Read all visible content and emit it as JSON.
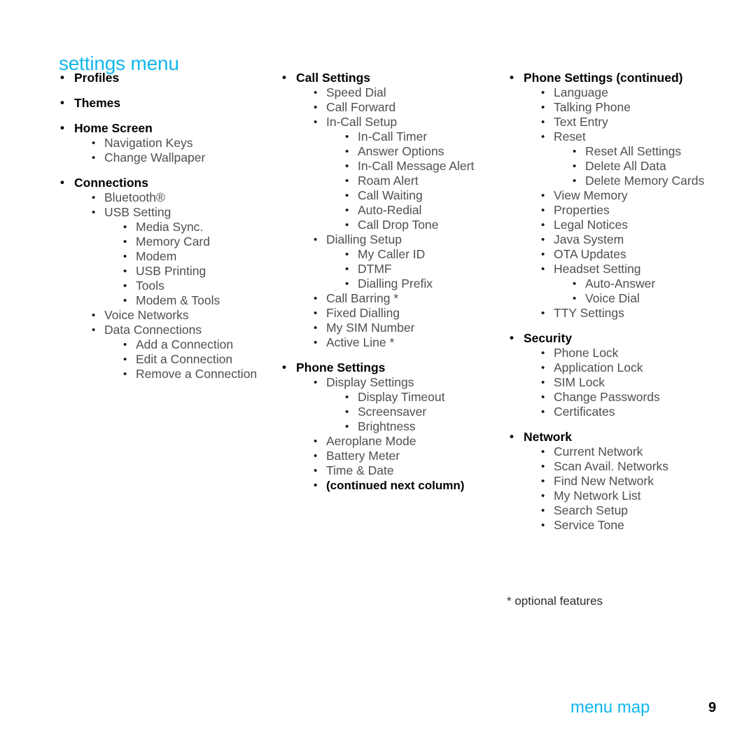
{
  "title": "settings menu",
  "bullet_glyph": "•",
  "colors": {
    "accent": "#11b7ec",
    "heading_text": "#000000",
    "sub_text": "#4f4f4f",
    "background": "#ffffff"
  },
  "footnote": "* optional features",
  "footer": {
    "label": "menu map",
    "page_number": "9"
  },
  "columns": [
    {
      "id": "column-1",
      "items": [
        {
          "level": 1,
          "label": "Profiles"
        },
        {
          "level": 1,
          "label": "Themes"
        },
        {
          "level": 1,
          "label": "Home Screen"
        },
        {
          "level": 2,
          "label": "Navigation Keys"
        },
        {
          "level": 2,
          "label": "Change Wallpaper"
        },
        {
          "level": 1,
          "label": "Connections"
        },
        {
          "level": 2,
          "label": "Bluetooth®"
        },
        {
          "level": 2,
          "label": "USB Setting"
        },
        {
          "level": 3,
          "label": "Media Sync."
        },
        {
          "level": 3,
          "label": "Memory Card"
        },
        {
          "level": 3,
          "label": "Modem"
        },
        {
          "level": 3,
          "label": "USB Printing"
        },
        {
          "level": 3,
          "label": "Tools"
        },
        {
          "level": 3,
          "label": "Modem & Tools"
        },
        {
          "level": 2,
          "label": "Voice Networks"
        },
        {
          "level": 2,
          "label": "Data Connections"
        },
        {
          "level": 3,
          "label": "Add a Connection"
        },
        {
          "level": 3,
          "label": "Edit a Connection"
        },
        {
          "level": 3,
          "label": "Remove a Connection"
        }
      ]
    },
    {
      "id": "column-2",
      "items": [
        {
          "level": 1,
          "label": "Call Settings"
        },
        {
          "level": 2,
          "label": "Speed Dial"
        },
        {
          "level": 2,
          "label": "Call Forward"
        },
        {
          "level": 2,
          "label": "In-Call Setup"
        },
        {
          "level": 3,
          "label": "In-Call Timer"
        },
        {
          "level": 3,
          "label": "Answer Options"
        },
        {
          "level": 3,
          "label": "In-Call Message Alert"
        },
        {
          "level": 3,
          "label": "Roam Alert"
        },
        {
          "level": 3,
          "label": "Call Waiting"
        },
        {
          "level": 3,
          "label": "Auto-Redial"
        },
        {
          "level": 3,
          "label": "Call Drop Tone"
        },
        {
          "level": 2,
          "label": "Dialling Setup"
        },
        {
          "level": 3,
          "label": "My Caller ID"
        },
        {
          "level": 3,
          "label": "DTMF"
        },
        {
          "level": 3,
          "label": "Dialling Prefix"
        },
        {
          "level": 2,
          "label": "Call Barring *"
        },
        {
          "level": 2,
          "label": "Fixed Dialling"
        },
        {
          "level": 2,
          "label": "My SIM Number"
        },
        {
          "level": 2,
          "label": "Active Line *"
        },
        {
          "level": 1,
          "label": "Phone Settings"
        },
        {
          "level": 2,
          "label": "Display Settings"
        },
        {
          "level": 3,
          "label": "Display Timeout"
        },
        {
          "level": 3,
          "label": "Screensaver"
        },
        {
          "level": 3,
          "label": "Brightness"
        },
        {
          "level": 2,
          "label": "Aeroplane Mode"
        },
        {
          "level": 2,
          "label": "Battery Meter"
        },
        {
          "level": 2,
          "label": "Time & Date"
        },
        {
          "level": 2,
          "label": "(continued next column)",
          "strong": true
        }
      ]
    },
    {
      "id": "column-3",
      "items": [
        {
          "level": 1,
          "label": "Phone Settings (continued)"
        },
        {
          "level": 2,
          "label": "Language"
        },
        {
          "level": 2,
          "label": "Talking Phone"
        },
        {
          "level": 2,
          "label": "Text Entry"
        },
        {
          "level": 2,
          "label": "Reset"
        },
        {
          "level": 3,
          "label": "Reset All Settings"
        },
        {
          "level": 3,
          "label": "Delete All Data"
        },
        {
          "level": 3,
          "label": "Delete Memory Cards"
        },
        {
          "level": 2,
          "label": "View Memory"
        },
        {
          "level": 2,
          "label": "Properties"
        },
        {
          "level": 2,
          "label": "Legal Notices"
        },
        {
          "level": 2,
          "label": "Java System"
        },
        {
          "level": 2,
          "label": "OTA Updates"
        },
        {
          "level": 2,
          "label": "Headset Setting"
        },
        {
          "level": 3,
          "label": "Auto-Answer"
        },
        {
          "level": 3,
          "label": "Voice Dial"
        },
        {
          "level": 2,
          "label": "TTY Settings"
        },
        {
          "level": 1,
          "label": "Security"
        },
        {
          "level": 2,
          "label": "Phone Lock"
        },
        {
          "level": 2,
          "label": "Application Lock"
        },
        {
          "level": 2,
          "label": "SIM Lock"
        },
        {
          "level": 2,
          "label": "Change Passwords"
        },
        {
          "level": 2,
          "label": "Certificates"
        },
        {
          "level": 1,
          "label": "Network"
        },
        {
          "level": 2,
          "label": "Current Network"
        },
        {
          "level": 2,
          "label": "Scan Avail. Networks"
        },
        {
          "level": 2,
          "label": "Find New Network"
        },
        {
          "level": 2,
          "label": "My Network List"
        },
        {
          "level": 2,
          "label": "Search Setup"
        },
        {
          "level": 2,
          "label": "Service Tone"
        }
      ]
    }
  ]
}
